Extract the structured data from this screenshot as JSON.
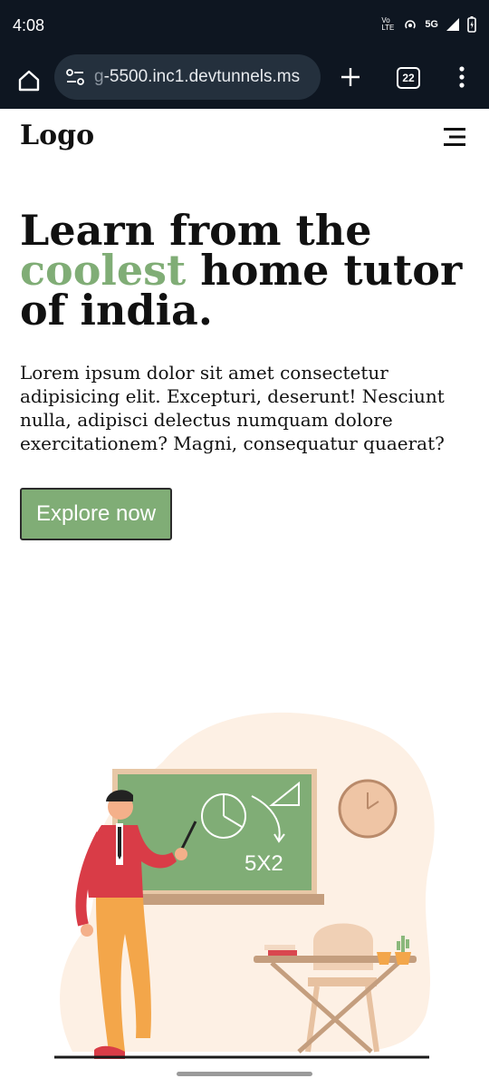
{
  "status": {
    "time": "4:08",
    "icons": [
      "volte-icon",
      "hotspot-icon",
      "5g-icon",
      "signal-icon",
      "battery-icon"
    ],
    "network_label": "5G",
    "volte_label": "Vo LTE"
  },
  "browser": {
    "url_dim": "g",
    "url": "-5500.inc1.devtunnels.ms",
    "tab_count": "22"
  },
  "nav": {
    "logo": "Logo"
  },
  "hero": {
    "title_line1": "Learn from the",
    "title_accent": "coolest",
    "title_rest": " home tutor",
    "title_line3": "of india.",
    "description": "Lorem ipsum dolor sit amet consectetur adipisicing elit. Excepturi, deserunt! Nesciunt nulla, adipisci delectus numquam dolore exercitationem? Magni, consequatur quaerat?",
    "button_label": "Explore now"
  },
  "illustration": {
    "board_text": "5X2"
  },
  "colors": {
    "accent": "#80ad76",
    "browser_bg": "#0e1621",
    "url_pill": "#24303d"
  }
}
